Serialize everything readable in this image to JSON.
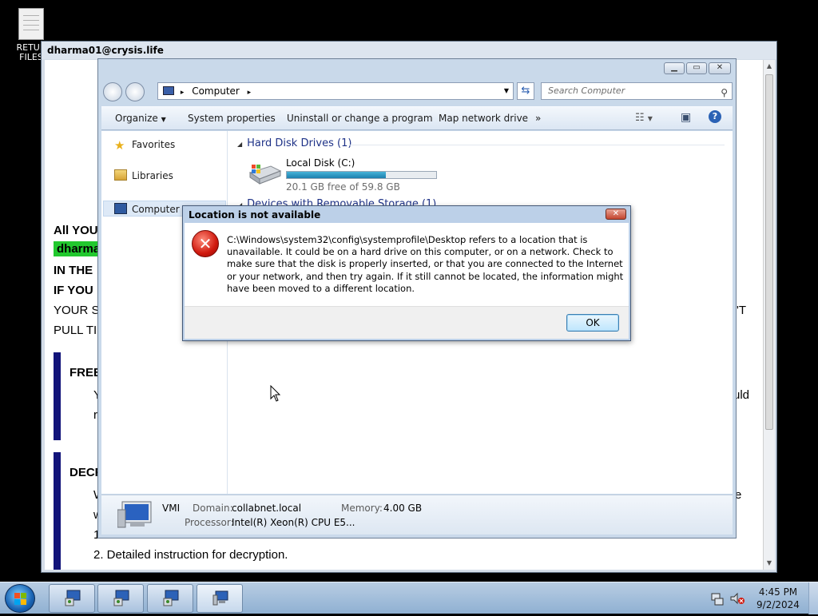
{
  "desktop": {
    "icon_label_line1": "RETUR",
    "icon_label_line2": "FILES"
  },
  "ransom_note": {
    "window_title": "dharma01@crysis.life",
    "lines": {
      "all_you": "All YOU",
      "email_tag": "dharma",
      "in_the": "IN THE",
      "if_you": "IF YOU",
      "your_s": "YOUR SI",
      "pull_tim": "PULL TIM",
      "free": "FREE",
      "free_y": "Y",
      "free_r": "r",
      "right_t": "'T",
      "right_uld": "uld",
      "decr": "DECR",
      "decr_w": "W",
      "decr_w2": "w",
      "decr_1": "1.",
      "right_e": "e",
      "decr_2": "2. Detailed instruction for decryption."
    }
  },
  "explorer": {
    "address": "Computer",
    "search_placeholder": "Search Computer",
    "toolbar": {
      "organize": "Organize",
      "system_properties": "System properties",
      "uninstall": "Uninstall or change a program",
      "map_drive": "Map network drive",
      "more": "»"
    },
    "nav": {
      "favorites": "Favorites",
      "libraries": "Libraries",
      "computer": "Computer"
    },
    "hard_disk_group": "Hard Disk Drives (1)",
    "removable_group": "Devices with Removable Storage (1)",
    "drive": {
      "name": "Local Disk (C:)",
      "free_text": "20.1 GB free of 59.8 GB",
      "used_fraction": 0.664
    },
    "details": {
      "computer_name": "VMI",
      "domain_label": "Domain:",
      "domain_value": "collabnet.local",
      "memory_label": "Memory:",
      "memory_value": "4.00 GB",
      "processor_label": "Processor:",
      "processor_value": "Intel(R) Xeon(R) CPU E5..."
    }
  },
  "dialog": {
    "title": "Location is not available",
    "message": "C:\\Windows\\system32\\config\\systemprofile\\Desktop refers to a location that is unavailable. It could be on a hard drive on this computer, or on a network. Check to make sure that the disk is properly inserted, or that you are connected to the Internet or your network, and then try again. If it still cannot be located, the information might have been moved to a different location.",
    "ok_label": "OK"
  },
  "taskbar": {
    "time": "4:45 PM",
    "date": "9/2/2024"
  },
  "colors": {
    "ransom_highlight": "#22c82e",
    "ransom_bar": "#12147a",
    "error_red": "#d0190e",
    "drive_fill": "#1d7fae"
  }
}
